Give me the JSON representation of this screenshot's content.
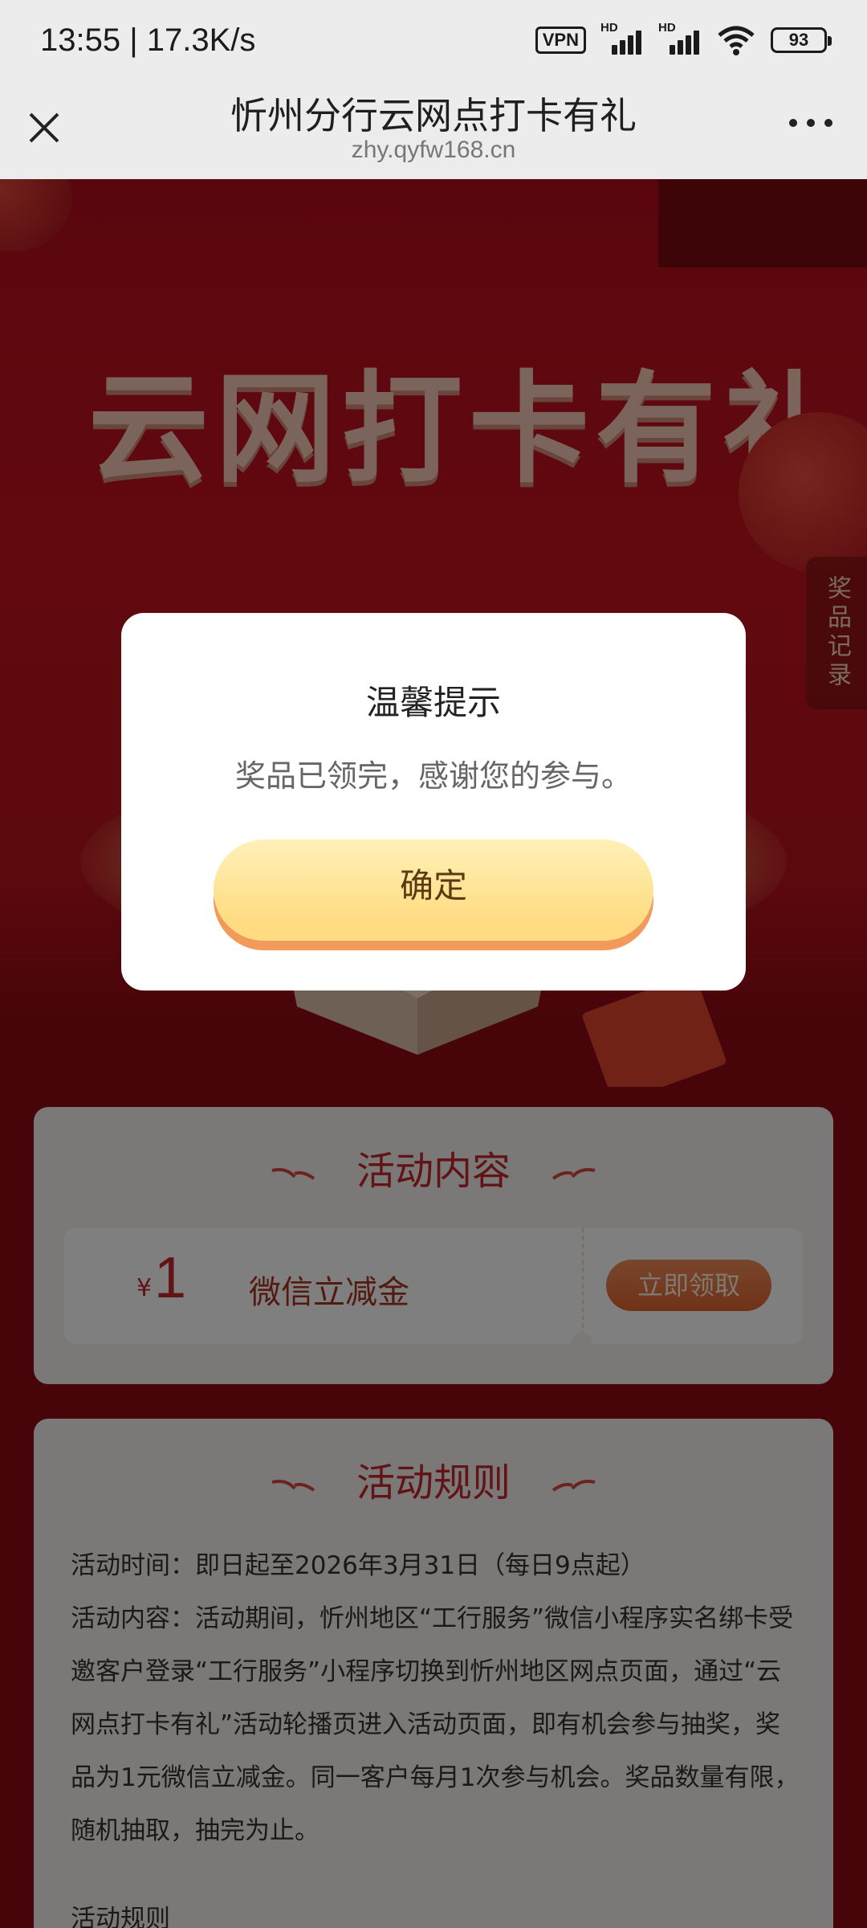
{
  "status_bar": {
    "time": "13:55",
    "speed": "17.3K/s",
    "vpn": "VPN",
    "hd1": "HD",
    "hd2": "HD",
    "battery": "93"
  },
  "browser": {
    "title": "忻州分行云网点打卡有礼",
    "url": "zhy.qyfw168.cn"
  },
  "banner": {
    "title_art": "云网打卡有礼",
    "prize_record": "奖品记录"
  },
  "activity_card": {
    "heading": "活动内容",
    "coupon": {
      "currency": "¥",
      "amount": "1",
      "name": "微信立减金",
      "button": "立即领取"
    }
  },
  "rules_card": {
    "heading": "活动规则",
    "lines": [
      "活动时间：即日起至2026年3月31日（每日9点起）",
      "活动内容：活动期间，忻州地区“工行服务”微信小程序实名绑卡受邀客户登录“工行服务”小程序切换到忻州地区网点页面，通过“云网点打卡有礼”活动轮播页进入活动页面，即有机会参与抽奖，奖品为1元微信立减金。同一客户每月1次参与机会。奖品数量有限，随机抽取，抽完为止。",
      "活动规则"
    ]
  },
  "modal": {
    "title": "温馨提示",
    "message": "奖品已领完，感谢您的参与。",
    "confirm": "确定"
  },
  "colors": {
    "page_red": "#b50d1c",
    "accent_red": "#c4262a",
    "coupon_button": "#e0642e",
    "modal_button": "#ffdc82"
  }
}
